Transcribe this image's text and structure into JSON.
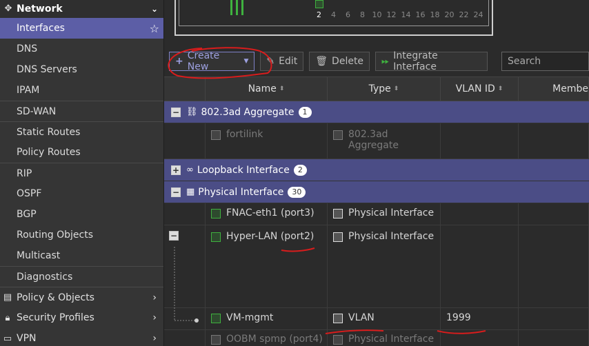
{
  "sidebar": {
    "header": {
      "label": "Network",
      "icon": "network-icon"
    },
    "items": [
      {
        "label": "Interfaces"
      },
      {
        "label": "DNS"
      },
      {
        "label": "DNS Servers"
      },
      {
        "label": "IPAM"
      },
      {
        "label": "SD-WAN"
      },
      {
        "label": "Static Routes"
      },
      {
        "label": "Policy Routes"
      },
      {
        "label": "RIP"
      },
      {
        "label": "OSPF"
      },
      {
        "label": "BGP"
      },
      {
        "label": "Routing Objects"
      },
      {
        "label": "Multicast"
      },
      {
        "label": "Diagnostics"
      }
    ],
    "main_items": [
      {
        "label": "Policy & Objects"
      },
      {
        "label": "Security Profiles"
      },
      {
        "label": "VPN"
      }
    ]
  },
  "ports": [
    "2",
    "4",
    "6",
    "8",
    "10",
    "12",
    "14",
    "16",
    "18",
    "20",
    "22",
    "24"
  ],
  "toolbar": {
    "create_new": "Create New",
    "edit": "Edit",
    "delete": "Delete",
    "integrate": "Integrate Interface",
    "search_placeholder": "Search"
  },
  "table": {
    "headers": {
      "name": "Name",
      "type": "Type",
      "vlan": "VLAN ID",
      "members": "Membe"
    },
    "groups": {
      "aggregate": {
        "label": "802.3ad Aggregate",
        "count": "1"
      },
      "loopback": {
        "label": "Loopback Interface",
        "count": "2"
      },
      "physical": {
        "label": "Physical Interface",
        "count": "30"
      }
    },
    "rows": {
      "fortilink": {
        "name": "fortilink",
        "type": "802.3ad Aggregate"
      },
      "fnac": {
        "name": "FNAC-eth1 (port3)",
        "type": "Physical Interface"
      },
      "hyper": {
        "name": "Hyper-LAN (port2)",
        "type": "Physical Interface"
      },
      "vmmgmt": {
        "name": "VM-mgmt",
        "type": "VLAN",
        "vlan": "1999"
      },
      "oobm": {
        "name": "OOBM spmp (port4)",
        "type": "Physical Interface"
      }
    }
  },
  "colors": {
    "accent": "#5c5ea6",
    "group": "#4b4d86",
    "annotation": "#d91c1c"
  }
}
